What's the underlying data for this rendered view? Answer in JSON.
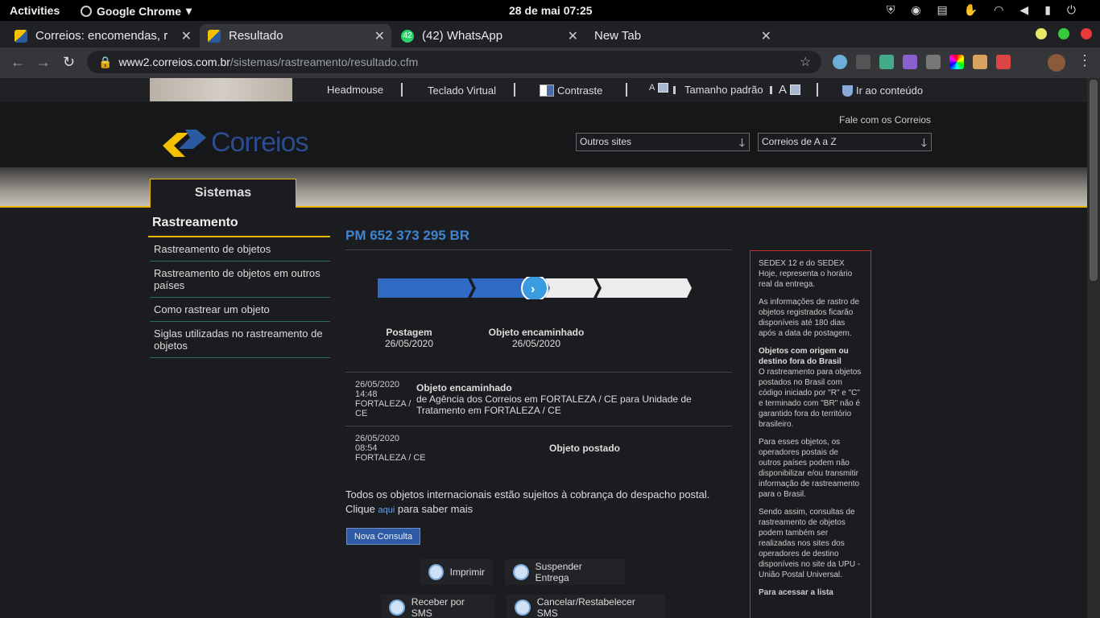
{
  "system": {
    "activities": "Activities",
    "app": "Google Chrome",
    "clock": "28 de mai  07:25"
  },
  "tabs": [
    {
      "title": "Correios: encomendas, ra"
    },
    {
      "title": "Resultado"
    },
    {
      "title": "(42) WhatsApp",
      "badge": "42"
    },
    {
      "title": "New Tab"
    }
  ],
  "address": {
    "host": "www2.correios.com.br",
    "path": "/sistemas/rastreamento/resultado.cfm"
  },
  "accessibility": {
    "headmouse": "Headmouse",
    "teclado": "Teclado Virtual",
    "contraste": "Contraste",
    "a_minus": "A",
    "tamanho": "Tamanho padrão",
    "a_plus": "A",
    "ir_conteudo": "Ir ao conteúdo"
  },
  "header": {
    "logo": "Correios",
    "fale": "Fale com os Correios",
    "select1": "Outros sites",
    "select2": "Correios de A a Z"
  },
  "systab": "Sistemas",
  "sidebar": {
    "title": "Rastreamento",
    "items": [
      "Rastreamento de objetos",
      "Rastreamento de objetos em outros países",
      "Como rastrear um objeto",
      "Siglas utilizadas no rastreamento de objetos"
    ]
  },
  "tracking": {
    "code": "PM 652 373 295 BR",
    "steps": [
      {
        "label": "Postagem",
        "date": "26/05/2020"
      },
      {
        "label": "Objeto encaminhado",
        "date": "26/05/2020"
      }
    ],
    "events": [
      {
        "date": "26/05/2020",
        "time": "14:48",
        "place": "FORTALEZA / CE",
        "title": "Objeto encaminhado",
        "detail": "de Agência dos Correios em FORTALEZA / CE para Unidade de Tratamento em FORTALEZA / CE"
      },
      {
        "date": "26/05/2020",
        "time": "08:54",
        "place": "FORTALEZA / CE",
        "title": "Objeto postado"
      }
    ],
    "note_pre": "Todos os objetos internacionais estão sujeitos à cobrança do despacho postal. Clique ",
    "note_link": "aqui",
    "note_post": " para saber mais",
    "nova": "Nova Consulta",
    "actions": [
      "Imprimir",
      "Suspender Entrega",
      "Receber por SMS",
      "Cancelar/Restabelecer SMS"
    ]
  },
  "info": {
    "p1": "SEDEX 12 e do SEDEX Hoje, representa o horário real da entrega.",
    "p2": "As informações de rastro de objetos registrados ficarão disponíveis até 180 dias após a data de postagem.",
    "h3": "Objetos com origem ou destino fora do Brasil",
    "p3": "O rastreamento para objetos postados no Brasil com código iniciado por \"R\" e \"C\" e terminado com \"BR\" não é garantido fora do território brasileiro.",
    "p4": "Para esses objetos, os operadores postais de outros países podem não disponibilizar e/ou transmitir informação de rastreamento para o Brasil.",
    "p5": "Sendo assim, consultas de rastreamento de objetos podem também ser realizadas nos sites dos operadores de destino disponíveis no site da UPU - União Postal Universal.",
    "p6": "Para acessar a lista"
  },
  "colors": {
    "accent": "#e6b800",
    "blue": "#2f6bc4",
    "alert": "#c0302f"
  }
}
